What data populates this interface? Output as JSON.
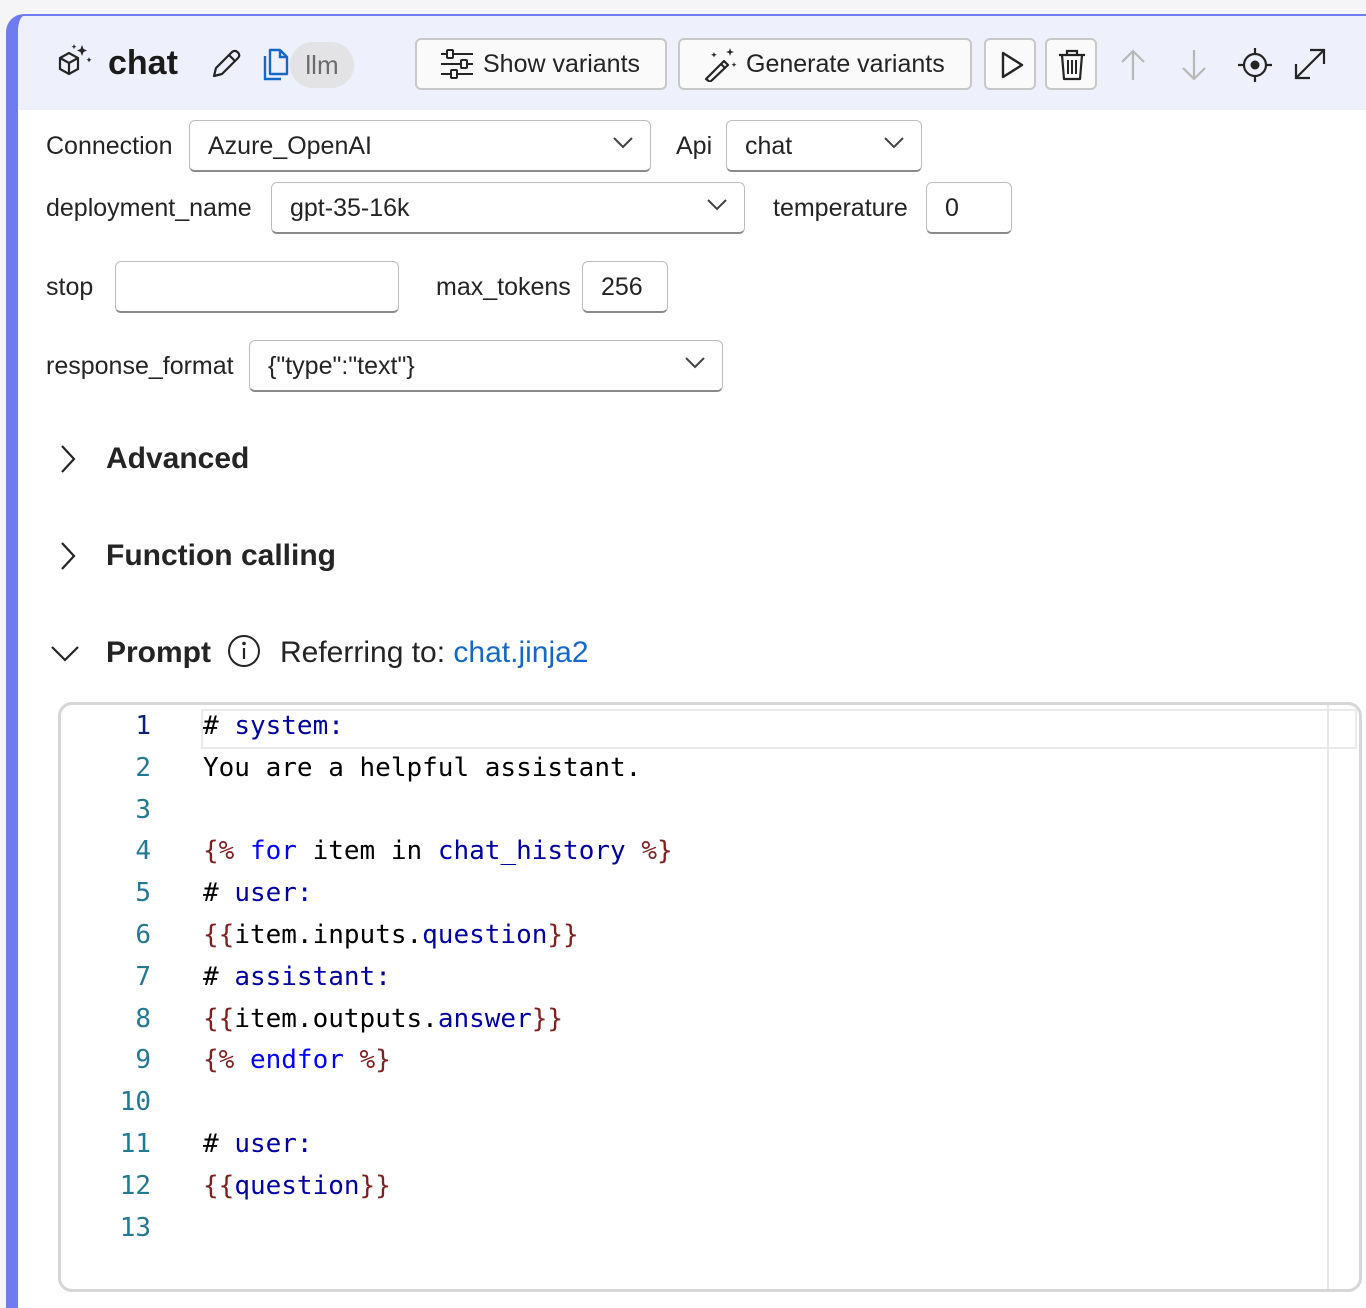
{
  "node": {
    "title": "chat",
    "type_badge": "llm",
    "show_variants_label": "Show variants",
    "generate_variants_label": "Generate variants"
  },
  "fields": {
    "connection_label": "Connection",
    "connection_value": "Azure_OpenAI",
    "api_label": "Api",
    "api_value": "chat",
    "deployment_label": "deployment_name",
    "deployment_value": "gpt-35-16k",
    "temperature_label": "temperature",
    "temperature_value": "0",
    "stop_label": "stop",
    "stop_value": "",
    "max_tokens_label": "max_tokens",
    "max_tokens_value": "256",
    "response_format_label": "response_format",
    "response_format_value": "{\"type\":\"text\"}"
  },
  "sections": {
    "advanced": "Advanced",
    "function_calling": "Function calling",
    "prompt": "Prompt",
    "referring_to": "Referring to: ",
    "referring_file": "chat.jinja2"
  },
  "editor": {
    "line_numbers": [
      "1",
      "2",
      "3",
      "4",
      "5",
      "6",
      "7",
      "8",
      "9",
      "10",
      "11",
      "12",
      "13"
    ],
    "lines": [
      "# system:",
      "You are a helpful assistant.",
      "",
      "{% for item in chat_history %}",
      "# user:",
      "{{item.inputs.question}}",
      "# assistant:",
      "{{item.outputs.answer}}",
      "{% endfor %}",
      "",
      "# user:",
      "{{question}}",
      ""
    ]
  },
  "colors": {
    "accent_border": "#6f7cf0",
    "header_bg": "#eef0fb",
    "link": "#1668c7",
    "line_number": "#237893"
  }
}
